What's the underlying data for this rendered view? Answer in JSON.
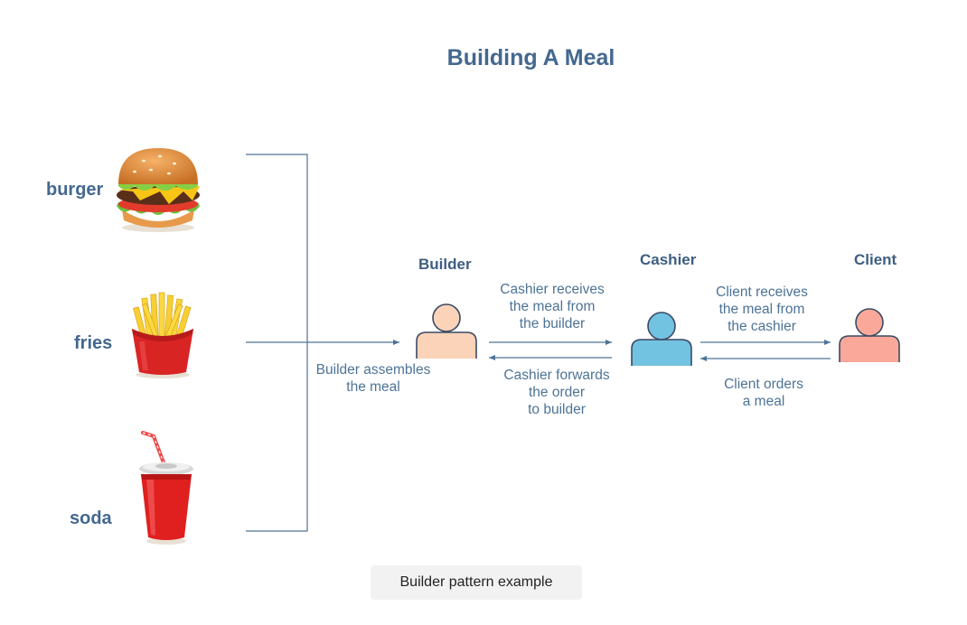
{
  "title": "Building A Meal",
  "foods": {
    "burger": "burger",
    "fries": "fries",
    "soda": "soda"
  },
  "roles": {
    "builder": "Builder",
    "cashier": "Cashier",
    "client": "Client"
  },
  "notes": {
    "builder_assembles": [
      "Builder assembles",
      "the meal"
    ],
    "cashier_receives": [
      "Cashier receives",
      "the meal from",
      "the builder"
    ],
    "cashier_forwards": [
      "Cashier forwards",
      "the order",
      "to builder"
    ],
    "client_receives": [
      "Client receives",
      "the meal from",
      "the cashier"
    ],
    "client_orders": [
      "Client orders",
      "a meal"
    ]
  },
  "caption": "Builder pattern example",
  "colors": {
    "title": "#44688f",
    "line": "#4d7396",
    "builder": "#fbd3b8",
    "cashier": "#72c2e1",
    "client": "#f9a89a"
  }
}
